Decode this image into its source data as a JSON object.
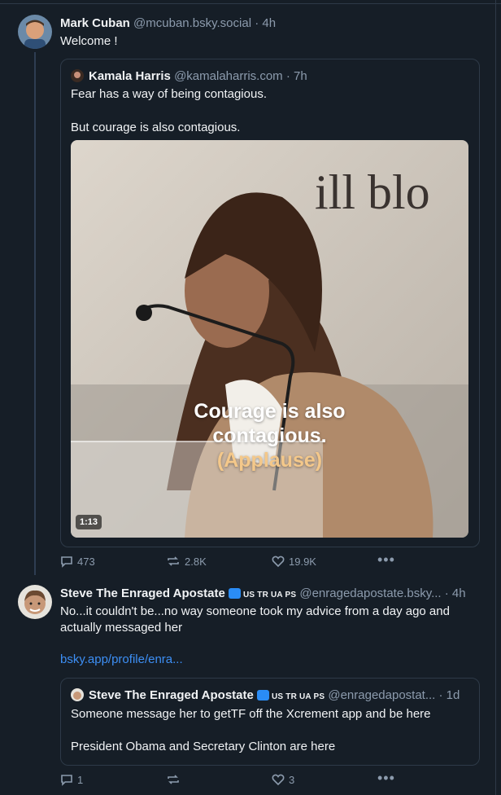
{
  "post1": {
    "name": "Mark Cuban",
    "handle": "@mcuban.bsky.social",
    "time": "· 4h",
    "text": "Welcome !",
    "quote": {
      "name": "Kamala Harris",
      "handle": "@kamalaharris.com",
      "time": "· 7h",
      "line1": "Fear has a way of being contagious.",
      "line2": "But courage is also contagious.",
      "video": {
        "caption_line1": "Courage is also",
        "caption_line2": "contagious.",
        "caption_line3": "(Applause)",
        "duration": "1:13",
        "sign_text": "ill blo"
      }
    },
    "actions": {
      "replies": "473",
      "reposts": "2.8K",
      "likes": "19.9K"
    }
  },
  "post2": {
    "name": "Steve The Enraged Apostate",
    "flags": "US TR UA PS",
    "handle": "@enragedapostate.bsky...",
    "time": "· 4h",
    "text": "No...it couldn't be...no way someone took my advice from a day ago and actually messaged her",
    "link": "bsky.app/profile/enra...",
    "quote": {
      "name": "Steve The Enraged Apostate",
      "flags": "US TR UA PS",
      "handle": "@enragedapostat...",
      "time": "· 1d",
      "line1": "Someone message her to getTF off the Xcrement app and be here",
      "line2": "President Obama and Secretary Clinton are here"
    },
    "actions": {
      "replies": "1",
      "reposts": "",
      "likes": "3"
    }
  },
  "colors": {
    "background": "#161e27",
    "link": "#3d8ff5",
    "muted": "#8c9bad",
    "border": "#2e3a48"
  }
}
